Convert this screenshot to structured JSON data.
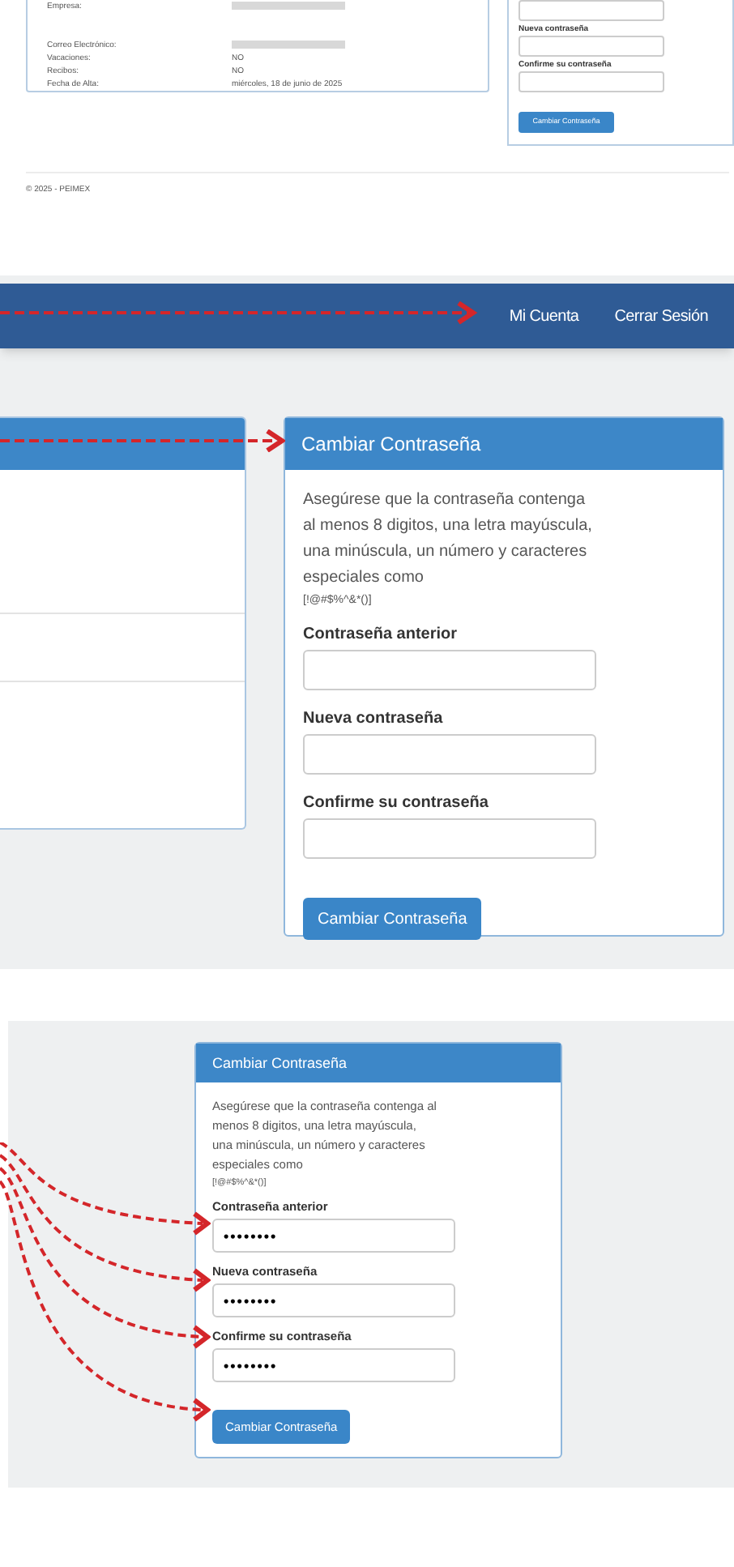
{
  "top_section": {
    "info_rows": [
      {
        "label": "Empresa:",
        "kind": "redacted"
      },
      {
        "label": "Correo Electrónico:",
        "kind": "redacted"
      },
      {
        "label": "Vacaciones:",
        "kind": "text",
        "value": "NO"
      },
      {
        "label": "Recibos:",
        "kind": "text",
        "value": "NO"
      },
      {
        "label": "Fecha de Alta:",
        "kind": "text",
        "value": "miércoles, 18 de junio de 2025"
      }
    ],
    "password_form": {
      "fields": [
        {
          "kind": "unlabeled"
        },
        {
          "kind": "labeled",
          "label": "Nueva contraseña"
        },
        {
          "kind": "labeled",
          "label": "Confirme su contraseña"
        }
      ],
      "button": "Cambiar Contraseña"
    },
    "footer": "© 2025 - PEIMEX"
  },
  "nav_section": {
    "links": [
      "Mi Cuenta",
      "Cerrar Sesión"
    ],
    "card": {
      "title": "Cambiar Contraseña",
      "description": "Asegúrese que la contraseña contenga al menos 8 digitos, una letra mayúscula, una minúscula, un número y caracteres especiales como",
      "special_chars": "[!@#$%^&*()]",
      "fields": [
        {
          "label": "Contraseña anterior"
        },
        {
          "label": "Nueva contraseña"
        },
        {
          "label": "Confirme su contraseña"
        }
      ],
      "button": "Cambiar Contraseña"
    }
  },
  "filled_section": {
    "card": {
      "title": "Cambiar Contraseña",
      "description": "Asegúrese que la contraseña contenga al menos 8 digitos, una letra mayúscula, una minúscula, un número y caracteres especiales como",
      "special_chars": "[!@#$%^&*()]",
      "fields": [
        {
          "label": "Contraseña anterior",
          "value": "••••••••"
        },
        {
          "label": "Nueva contraseña",
          "value": "••••••••"
        },
        {
          "label": "Confirme su contraseña",
          "value": "••••••••"
        }
      ],
      "button": "Cambiar Contraseña"
    }
  }
}
